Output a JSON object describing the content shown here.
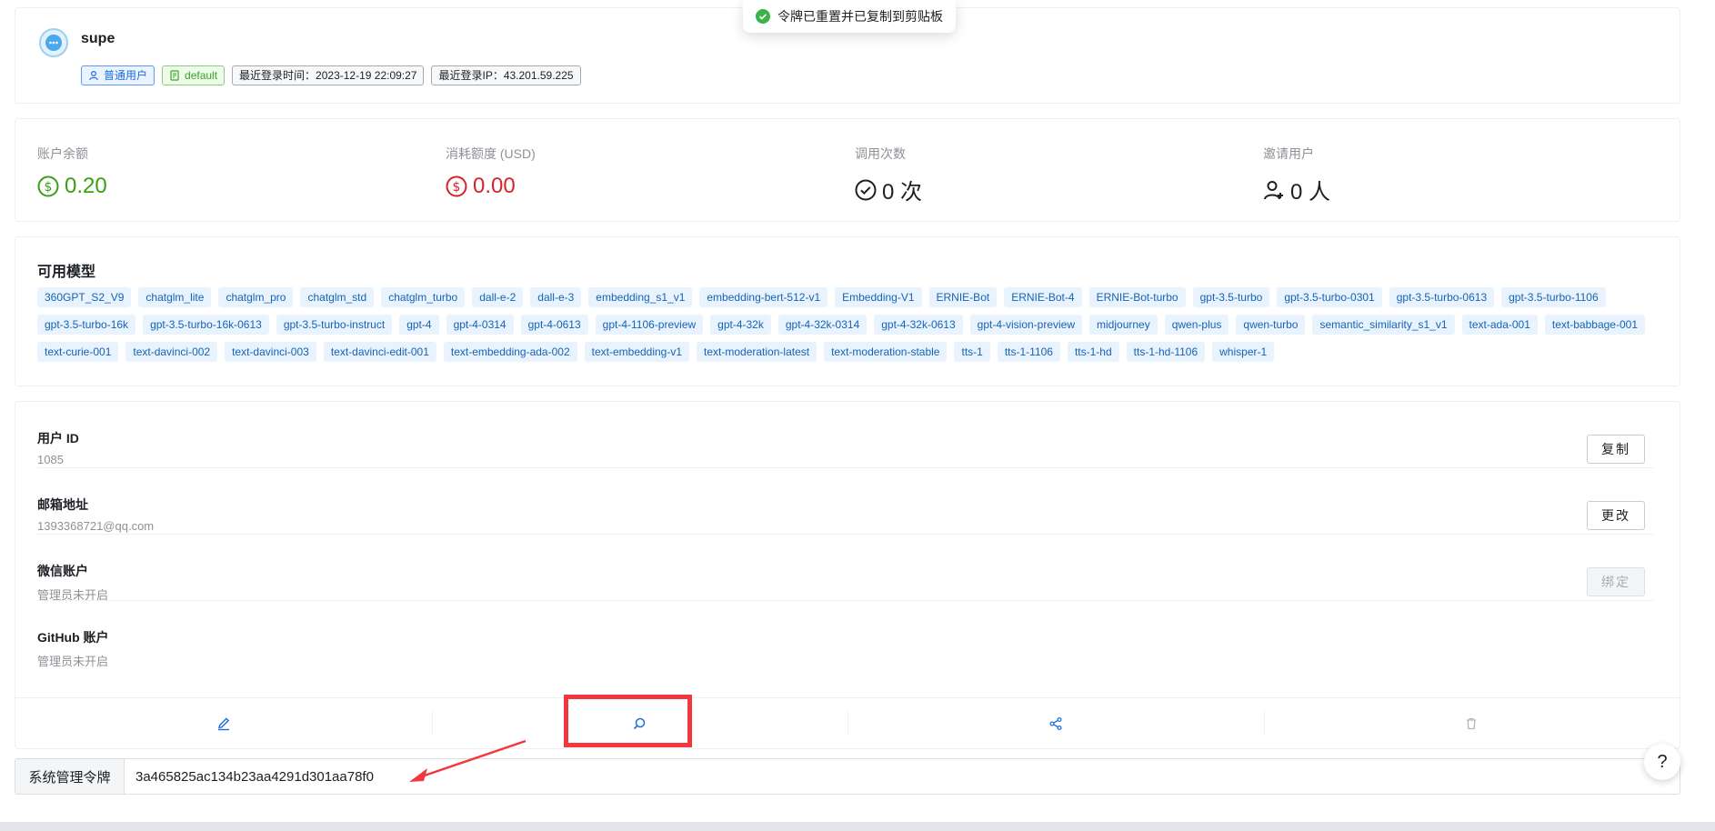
{
  "profile": {
    "username": "supe",
    "role_tag": "普通用户",
    "group_tag": "default",
    "last_login_time": "最近登录时间：2023-12-19 22:09:27",
    "last_login_ip": "最近登录IP：43.201.59.225"
  },
  "toast": {
    "message": "令牌已重置并已复制到剪贴板"
  },
  "stats": [
    {
      "label": "账户余额",
      "value": "0.20",
      "color": "#3b9f14",
      "icon": "dollar-circle-icon"
    },
    {
      "label": "消耗额度 (USD)",
      "value": "0.00",
      "color": "#d5242b",
      "icon": "dollar-circle-icon"
    },
    {
      "label": "调用次数",
      "value": "0 次",
      "color": "#1c1f23",
      "icon": "check-circle-icon"
    },
    {
      "label": "邀请用户",
      "value": "0 人",
      "color": "#1c1f23",
      "icon": "user-add-icon"
    }
  ],
  "models": {
    "title": "可用模型",
    "items": [
      "360GPT_S2_V9",
      "chatglm_lite",
      "chatglm_pro",
      "chatglm_std",
      "chatglm_turbo",
      "dall-e-2",
      "dall-e-3",
      "embedding_s1_v1",
      "embedding-bert-512-v1",
      "Embedding-V1",
      "ERNIE-Bot",
      "ERNIE-Bot-4",
      "ERNIE-Bot-turbo",
      "gpt-3.5-turbo",
      "gpt-3.5-turbo-0301",
      "gpt-3.5-turbo-0613",
      "gpt-3.5-turbo-1106",
      "gpt-3.5-turbo-16k",
      "gpt-3.5-turbo-16k-0613",
      "gpt-3.5-turbo-instruct",
      "gpt-4",
      "gpt-4-0314",
      "gpt-4-0613",
      "gpt-4-1106-preview",
      "gpt-4-32k",
      "gpt-4-32k-0314",
      "gpt-4-32k-0613",
      "gpt-4-vision-preview",
      "midjourney",
      "qwen-plus",
      "qwen-turbo",
      "semantic_similarity_s1_v1",
      "text-ada-001",
      "text-babbage-001",
      "text-curie-001",
      "text-davinci-002",
      "text-davinci-003",
      "text-davinci-edit-001",
      "text-embedding-ada-002",
      "text-embedding-v1",
      "text-moderation-latest",
      "text-moderation-stable",
      "tts-1",
      "tts-1-1106",
      "tts-1-hd",
      "tts-1-hd-1106",
      "whisper-1"
    ]
  },
  "info": {
    "user_id": {
      "label": "用户 ID",
      "value": "1085",
      "button": "复制"
    },
    "email": {
      "label": "邮箱地址",
      "value": "1393368721@qq.com",
      "button": "更改"
    },
    "wechat": {
      "label": "微信账户",
      "value": "管理员未开启",
      "button": "绑定"
    },
    "github": {
      "label": "GitHub 账户",
      "value": "管理员未开启"
    }
  },
  "token": {
    "label": "系统管理令牌",
    "value": "3a465825ac134b23aa4291d301aa78f0"
  },
  "help": {
    "label": "?"
  },
  "colors": {
    "accent": "#1a6fe0",
    "highlight": "#f2373d"
  }
}
